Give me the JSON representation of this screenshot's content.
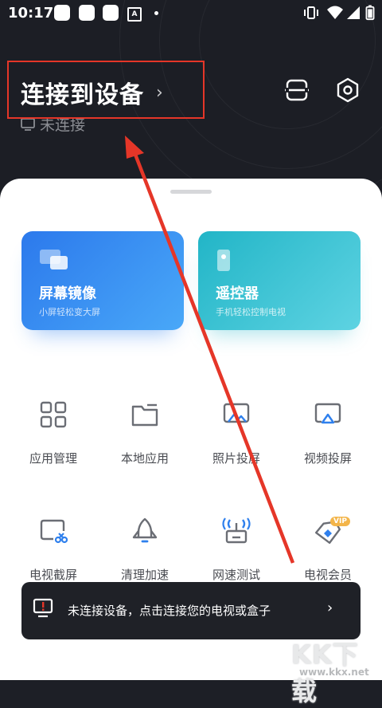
{
  "status_bar": {
    "time": "10:17",
    "a_icon": "A"
  },
  "header": {
    "title": "连接到设备",
    "chevron": "›",
    "connection_status": "未连接"
  },
  "cards": [
    {
      "title": "屏幕镜像",
      "subtitle": "小屏轻松变大屏",
      "color": "#2f80ed"
    },
    {
      "title": "遥控器",
      "subtitle": "手机轻松控制电视",
      "color": "#22b5c7"
    }
  ],
  "grid": [
    {
      "label": "应用管理",
      "icon": "apps-grid-icon"
    },
    {
      "label": "本地应用",
      "icon": "folder-icon"
    },
    {
      "label": "照片投屏",
      "icon": "photo-cast-icon"
    },
    {
      "label": "视频投屏",
      "icon": "video-cast-icon"
    },
    {
      "label": "电视截屏",
      "icon": "tv-screenshot-icon"
    },
    {
      "label": "清理加速",
      "icon": "rocket-icon"
    },
    {
      "label": "网速测试",
      "icon": "router-icon"
    },
    {
      "label": "电视会员",
      "icon": "vip-diamond-icon"
    }
  ],
  "vip_badge": "VIP",
  "toast": {
    "text": "未连接设备，点击连接您的电视或盒子",
    "chevron": "›"
  },
  "watermark": {
    "brand": "KK下载",
    "url": "www.kkx.net"
  },
  "colors": {
    "accent_red": "#e53628",
    "header_bg": "#1c1e25",
    "icon_gray": "#6b6e75"
  }
}
